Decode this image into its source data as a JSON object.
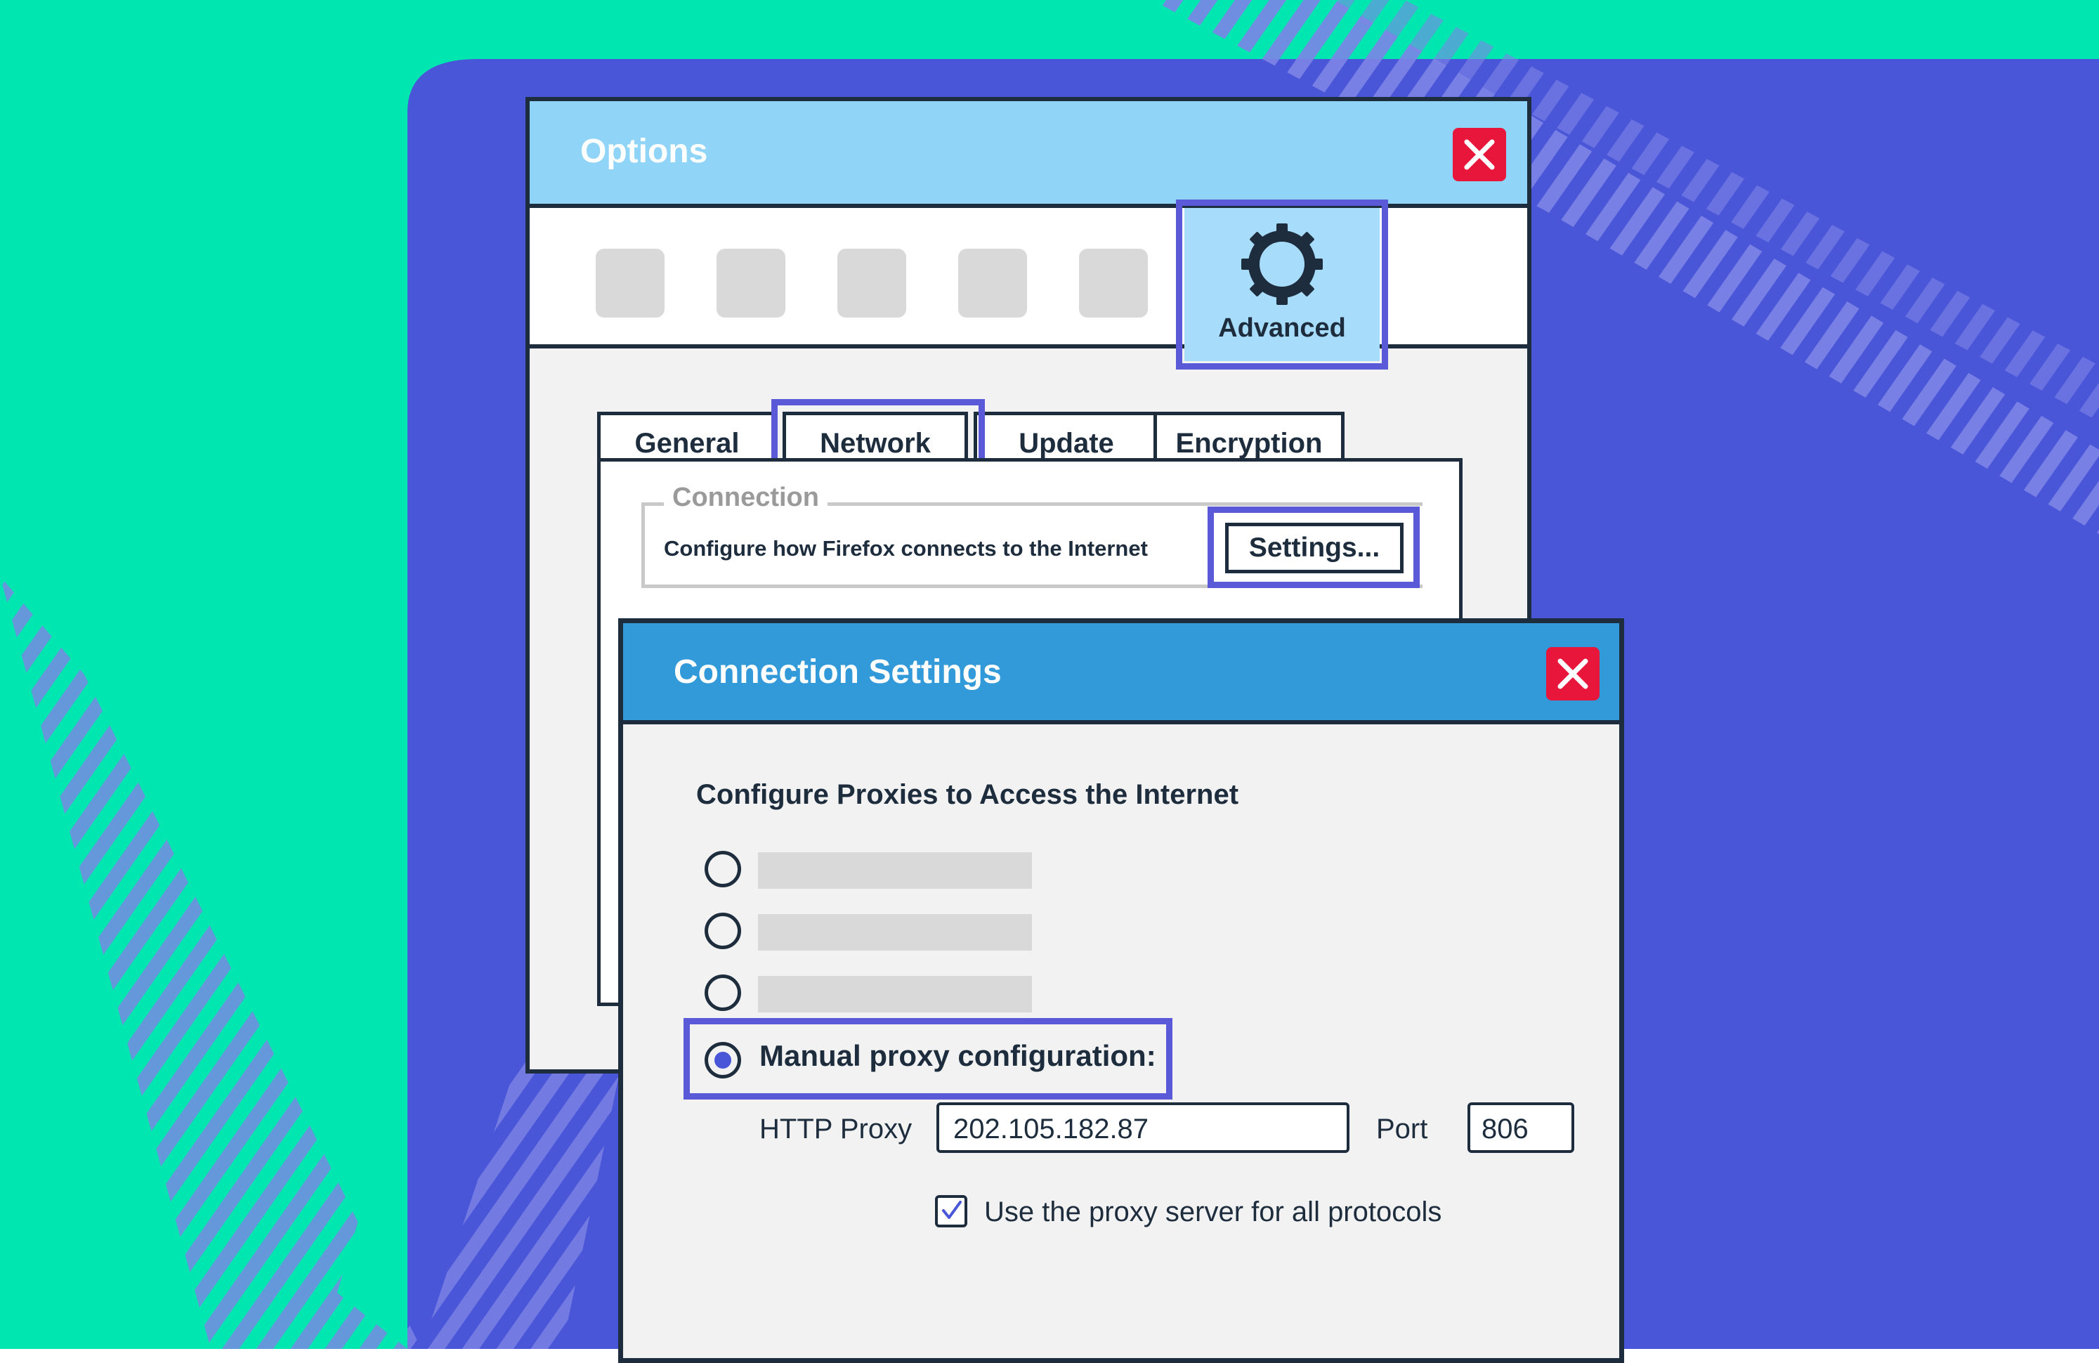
{
  "colors": {
    "background_green": "#00e6b0",
    "background_blue": "#4a56d8",
    "highlight": "#5a5ad8",
    "options_titlebar": "#90d4f7",
    "conn_titlebar": "#339ada",
    "close_red": "#e8163a"
  },
  "options_window": {
    "title": "Options",
    "toolbar": {
      "icons": [
        "blank",
        "blank",
        "blank",
        "blank",
        "blank"
      ],
      "advanced": {
        "label": "Advanced",
        "icon": "gear-icon",
        "selected": true
      }
    },
    "tabs": [
      "General",
      "Network",
      "Update",
      "Encryption"
    ],
    "selected_tab": "Network",
    "connection": {
      "legend": "Connection",
      "description": "Configure how Firefox connects to the Internet",
      "settings_button": "Settings..."
    }
  },
  "connection_settings": {
    "title": "Connection Settings",
    "heading": "Configure Proxies to Access the Internet",
    "options": [
      {
        "label": "",
        "selected": false
      },
      {
        "label": "",
        "selected": false
      },
      {
        "label": "",
        "selected": false
      },
      {
        "label": "Manual proxy configuration:",
        "selected": true
      }
    ],
    "http_proxy_label": "HTTP Proxy",
    "http_proxy_value": "202.105.182.87",
    "port_label": "Port",
    "port_value": "806",
    "use_for_all_label": "Use the proxy server for all protocols",
    "use_for_all_checked": true
  }
}
